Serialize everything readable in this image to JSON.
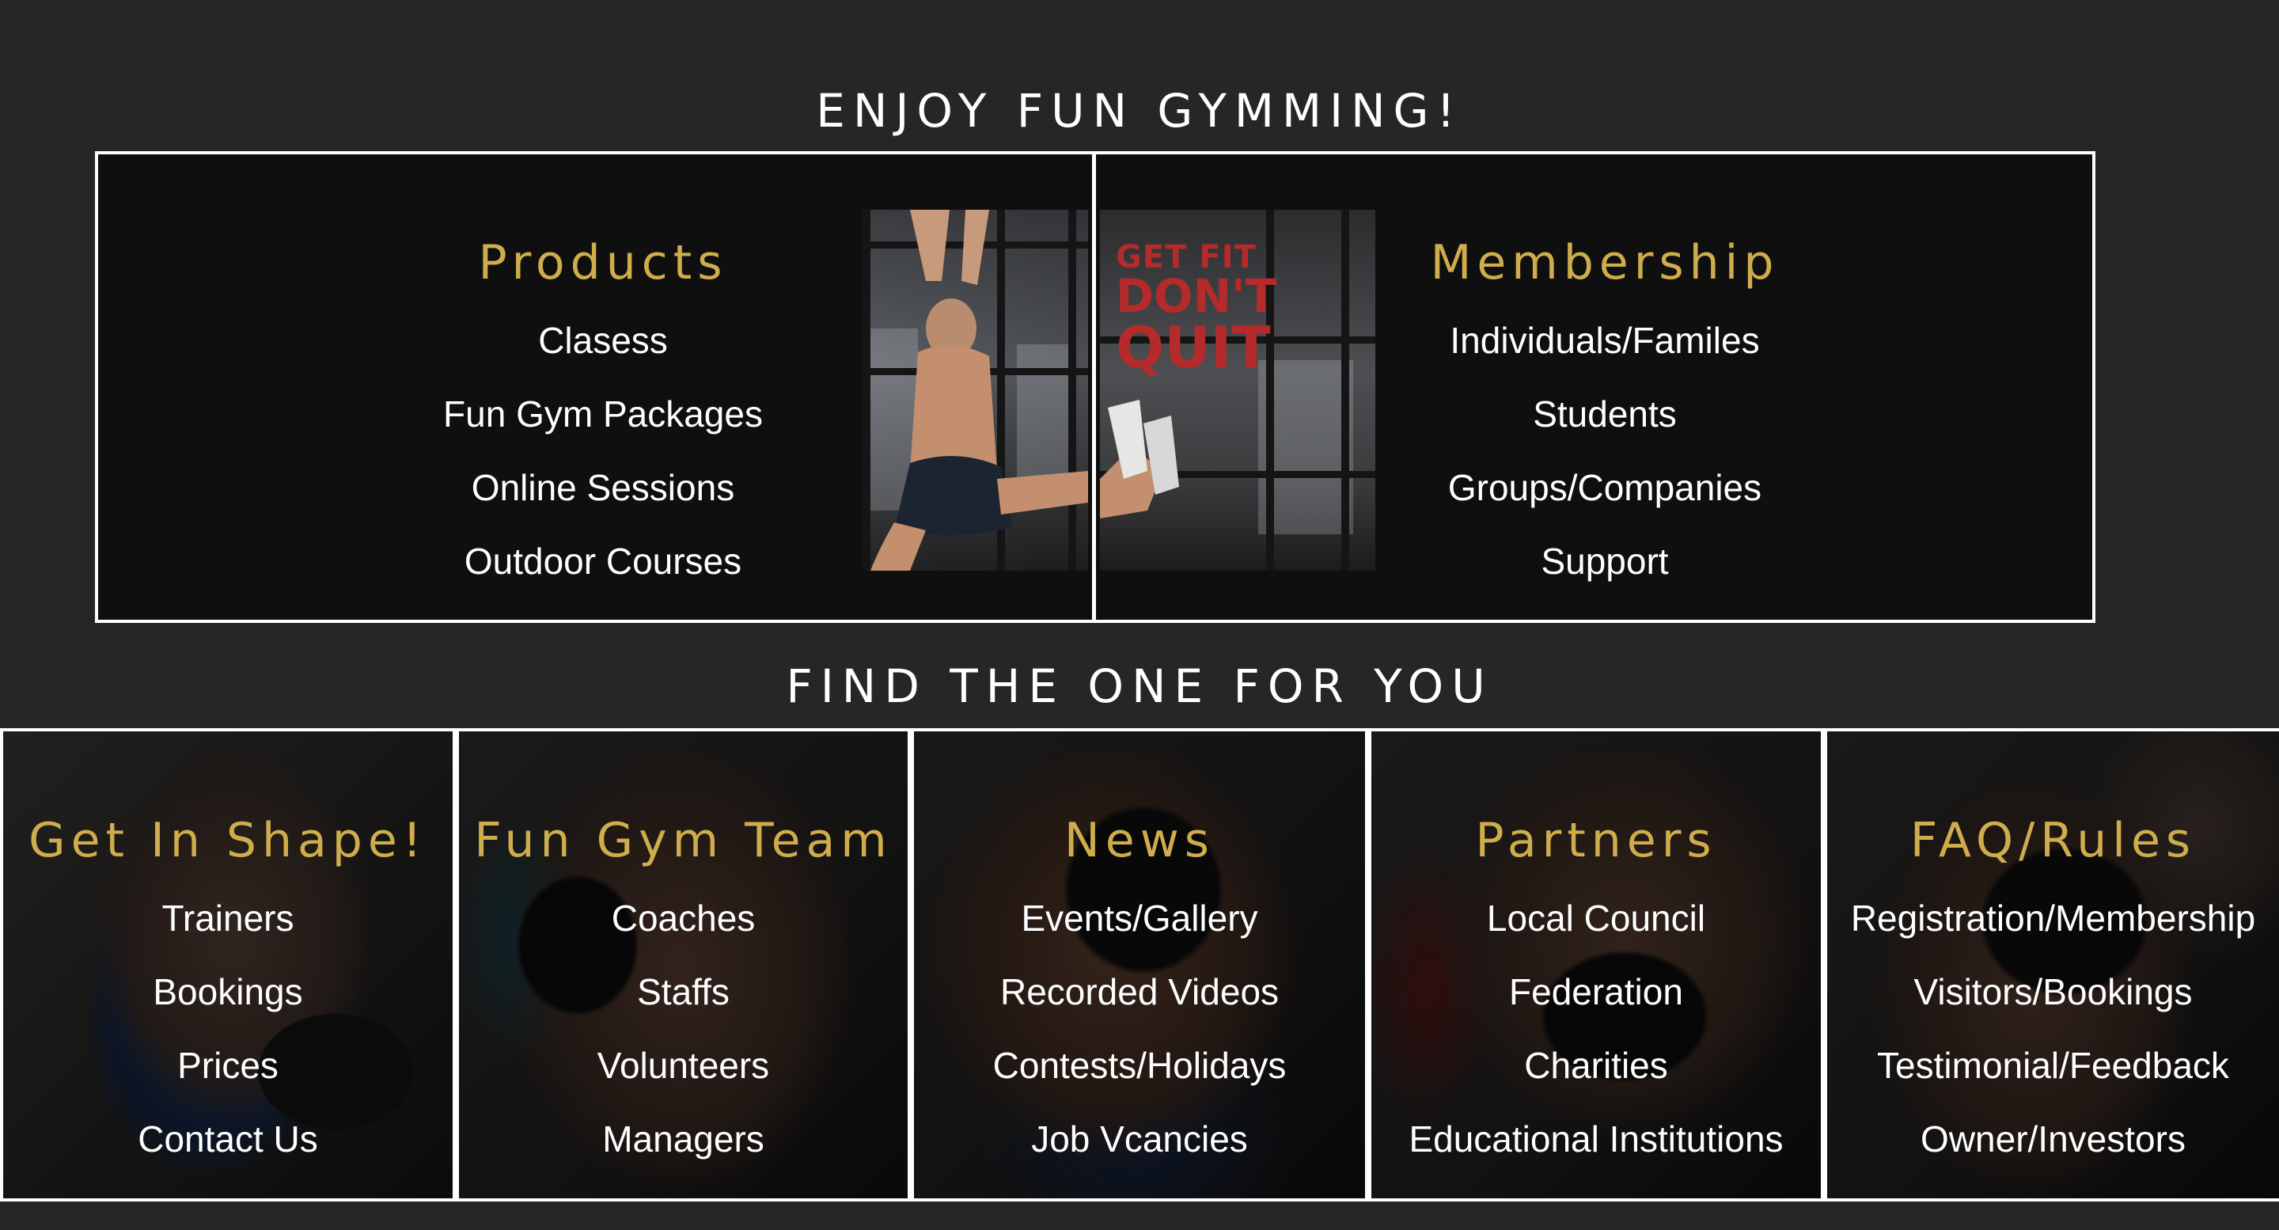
{
  "headings": {
    "top": "ENJOY FUN GYMMING!",
    "find": "FIND THE ONE FOR YOU"
  },
  "products": {
    "title": "Products",
    "items": [
      "Clasess",
      "Fun Gym Packages",
      "Online Sessions",
      "Outdoor Courses"
    ]
  },
  "membership": {
    "title": "Membership",
    "items": [
      "Individuals/Familes",
      "Students",
      "Groups/Companies",
      "Support"
    ]
  },
  "promo_image": {
    "slogan_line1": "GET FIT",
    "slogan_line2": "DON'T",
    "slogan_line3": "QUIT"
  },
  "cards": [
    {
      "title": "Get In Shape!",
      "items": [
        "Trainers",
        "Bookings",
        "Prices",
        "Contact Us"
      ]
    },
    {
      "title": "Fun Gym Team",
      "items": [
        "Coaches",
        "Staffs",
        "Volunteers",
        "Managers"
      ]
    },
    {
      "title": "News",
      "items": [
        "Events/Gallery",
        "Recorded Videos",
        "Contests/Holidays",
        "Job Vcancies"
      ]
    },
    {
      "title": "Partners",
      "items": [
        "Local Council",
        "Federation",
        "Charities",
        "Educational Institutions"
      ]
    },
    {
      "title": "FAQ/Rules",
      "items": [
        "Registration/Membership",
        "Visitors/Bookings",
        "Testimonial/Feedback",
        "Owner/Investors"
      ]
    }
  ],
  "colors": {
    "page_background": "#262626",
    "box_background": "#0f0f0f",
    "accent_gold": "#cfad4c",
    "text_white": "#ffffff",
    "slogan_red": "#b52a2a"
  }
}
